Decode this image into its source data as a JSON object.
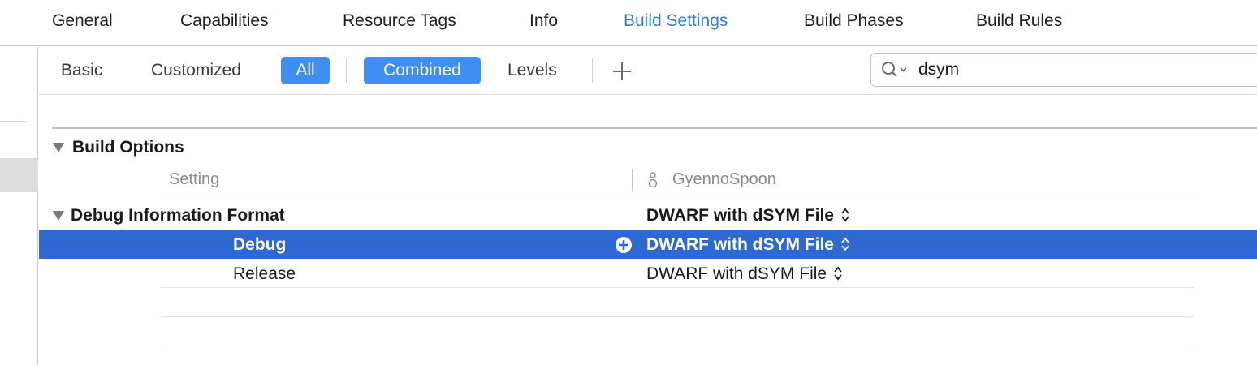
{
  "tabs": [
    {
      "label": "General"
    },
    {
      "label": "Capabilities"
    },
    {
      "label": "Resource Tags"
    },
    {
      "label": "Info"
    },
    {
      "label": "Build Settings"
    },
    {
      "label": "Build Phases"
    },
    {
      "label": "Build Rules"
    }
  ],
  "active_tab": "Build Settings",
  "filter": {
    "basic": "Basic",
    "customized": "Customized",
    "all": "All",
    "combined": "Combined",
    "levels": "Levels",
    "add_icon": "plus-icon"
  },
  "search": {
    "value": "dsym",
    "icon": "search-icon"
  },
  "build_options": {
    "title": "Build Options",
    "setting_header": "Setting",
    "target_header": "GyennoSpoon",
    "target_icon": "target-icon"
  },
  "debug_format": {
    "title": "Debug Information Format",
    "value": "DWARF with dSYM File",
    "rows": [
      {
        "name": "Debug",
        "value": "DWARF with dSYM File"
      },
      {
        "name": "Release",
        "value": "DWARF with dSYM File"
      }
    ]
  },
  "colors": {
    "accent": "#2f7ddc",
    "pill": "#3f8ef3",
    "selection": "#2e68d3"
  }
}
